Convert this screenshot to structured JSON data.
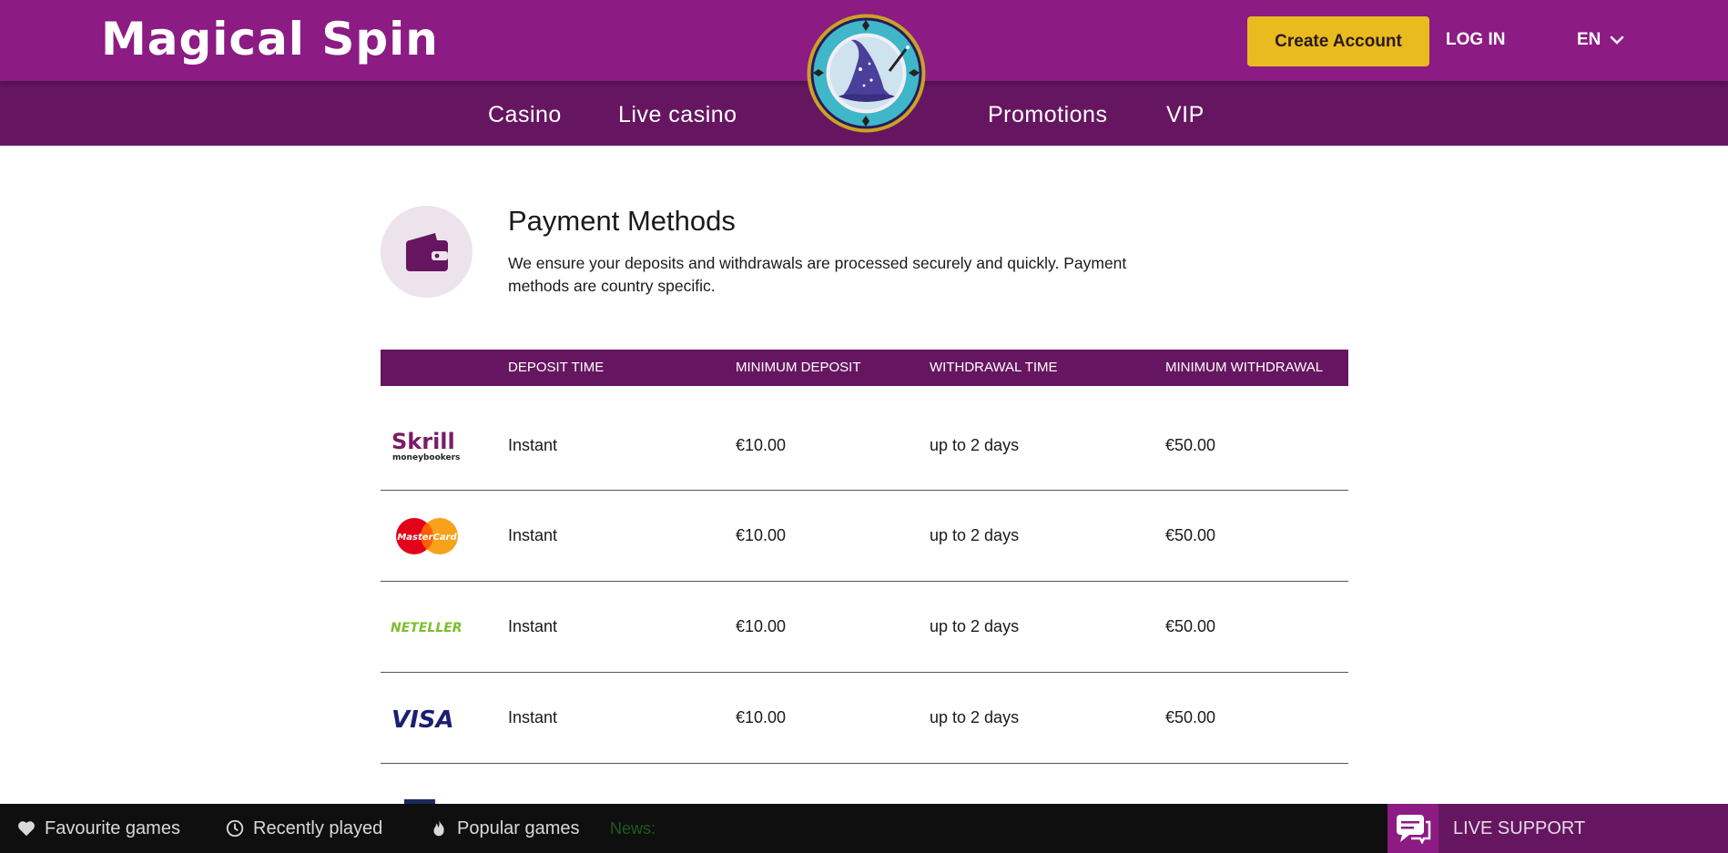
{
  "header": {
    "brand": "Magical Spin",
    "create_account_label": "Create Account",
    "login_label": "LOG IN",
    "language": "EN",
    "colors": {
      "top": "#8c1b84",
      "nav": "#661660",
      "accent": "#e9bb1e"
    }
  },
  "nav": {
    "items": [
      {
        "label": "Casino"
      },
      {
        "label": "Live casino"
      },
      {
        "label": "Promotions"
      },
      {
        "label": "VIP"
      }
    ]
  },
  "payments": {
    "title": "Payment Methods",
    "description": "We ensure your deposits and withdrawals are processed securely and quickly. Payment methods are country specific.",
    "icon": "wallet-icon",
    "columns": [
      "DEPOSIT TIME",
      "MINIMUM DEPOSIT",
      "WITHDRAWAL TIME",
      "MINIMUM WITHDRAWAL"
    ],
    "rows": [
      {
        "method": "Skrill",
        "logo_text": "Skrill",
        "logo_sub": "moneybookers",
        "deposit_time": "Instant",
        "min_deposit": "€10.00",
        "withdrawal_time": "up to 2 days",
        "min_withdrawal": "€50.00"
      },
      {
        "method": "MasterCard",
        "logo_text": "MasterCard",
        "deposit_time": "Instant",
        "min_deposit": "€10.00",
        "withdrawal_time": "up to 2 days",
        "min_withdrawal": "€50.00"
      },
      {
        "method": "Neteller",
        "logo_text": "NETELLER",
        "deposit_time": "Instant",
        "min_deposit": "€10.00",
        "withdrawal_time": "up to 2 days",
        "min_withdrawal": "€50.00"
      },
      {
        "method": "Visa",
        "logo_text": "VISA",
        "deposit_time": "Instant",
        "min_deposit": "€10.00",
        "withdrawal_time": "up to 2 days",
        "min_withdrawal": "€50.00"
      }
    ]
  },
  "bottom_bar": {
    "favourite_label": "Favourite games",
    "recent_label": "Recently played",
    "popular_label": "Popular games",
    "news_label": "News:",
    "support_label": "LIVE SUPPORT"
  }
}
